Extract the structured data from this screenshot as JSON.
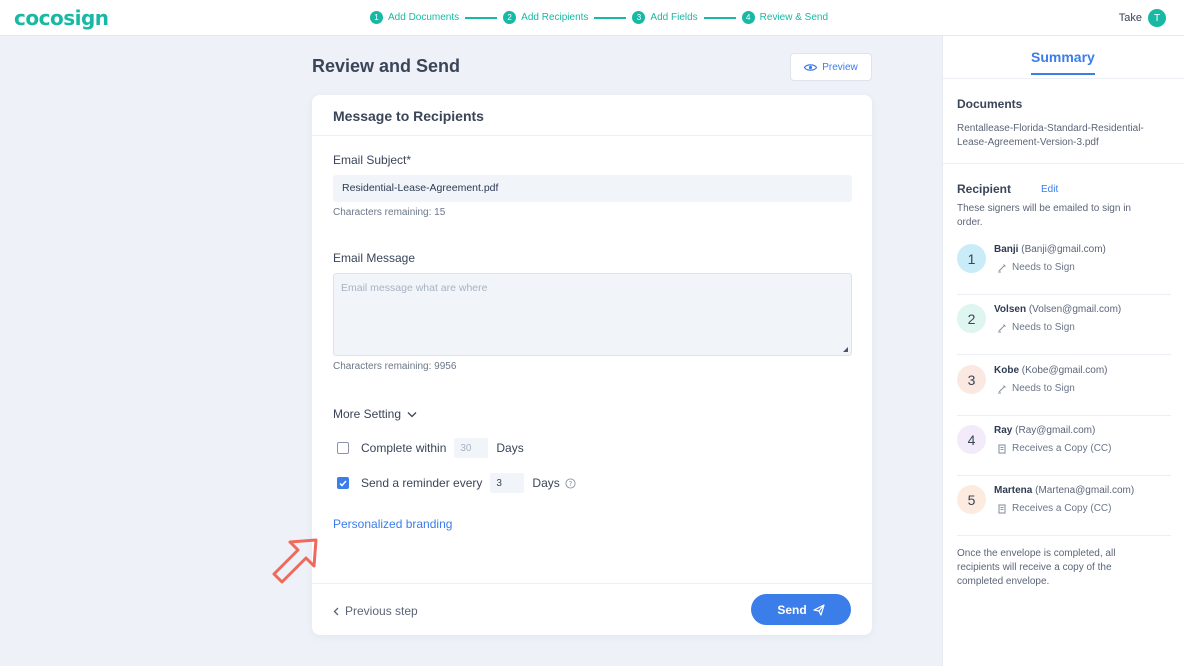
{
  "app": {
    "logo": "cocosign",
    "user_name": "Take",
    "user_initial": "T"
  },
  "steps": [
    {
      "num": "1",
      "label": "Add Documents"
    },
    {
      "num": "2",
      "label": "Add Recipients"
    },
    {
      "num": "3",
      "label": "Add Fields"
    },
    {
      "num": "4",
      "label": "Review & Send"
    }
  ],
  "main": {
    "title": "Review and Send",
    "preview_label": "Preview",
    "card_title": "Message to Recipients",
    "subject_label": "Email Subject*",
    "subject_value": "Residential-Lease-Agreement.pdf",
    "subject_hint": "Characters remaining: 15",
    "message_label": "Email Message",
    "message_placeholder": "Email message what are where",
    "message_hint": "Characters remaining: 9956",
    "more_setting": "More Setting",
    "complete_within_label": "Complete within",
    "complete_within_placeholder": "30",
    "complete_within_checked": false,
    "reminder_label": "Send a reminder every",
    "reminder_value": "3",
    "reminder_checked": true,
    "days_label": "Days",
    "branding_link": "Personalized branding",
    "prev_step": "Previous step",
    "send_label": "Send"
  },
  "summary": {
    "title": "Summary",
    "documents_title": "Documents",
    "document_name_line1": "Rentallease-Florida-Standard-Residential-",
    "document_name_line2": "Lease-Agreement-Version-3.pdf",
    "recipient_title": "Recipient",
    "edit_label": "Edit",
    "recipient_note_line1": "These signers will be emailed to sign in",
    "recipient_note_line2": "order.",
    "recipients": [
      {
        "num": "1",
        "name": "Banji",
        "email": "(Banji@gmail.com)",
        "role": "Needs to Sign",
        "color": "#c9ecf8"
      },
      {
        "num": "2",
        "name": "Volsen",
        "email": "(Volsen@gmail.com)",
        "role": "Needs to Sign",
        "color": "#dff5ef"
      },
      {
        "num": "3",
        "name": "Kobe",
        "email": "(Kobe@gmail.com)",
        "role": "Needs to Sign",
        "color": "#fbe9e1"
      },
      {
        "num": "4",
        "name": "Ray",
        "email": "(Ray@gmail.com)",
        "role": "Receives a Copy (CC)",
        "color": "#f3ebfa"
      },
      {
        "num": "5",
        "name": "Martena",
        "email": "(Martena@gmail.com)",
        "role": "Receives a Copy (CC)",
        "color": "#fdebe0"
      }
    ],
    "footer_line1": "Once the envelope is completed, all",
    "footer_line2": "recipients will receive a copy of the",
    "footer_line3": "completed envelope."
  },
  "colors": {
    "brand": "#18b9a4",
    "accent": "#3b7de9",
    "annotation_arrow": "#ef6a5a"
  }
}
